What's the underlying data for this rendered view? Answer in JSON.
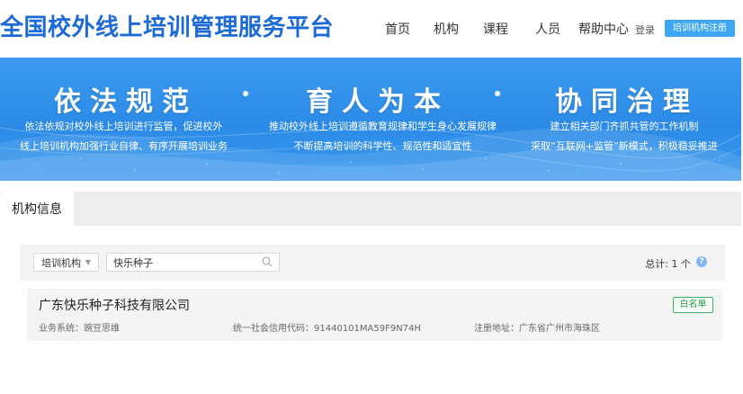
{
  "header": {
    "site_title": "全国校外线上培训管理服务平台",
    "nav": [
      {
        "label": "首页"
      },
      {
        "label": "机构"
      },
      {
        "label": "课程"
      },
      {
        "label": "人员"
      },
      {
        "label": "帮助中心"
      }
    ],
    "login_label": "登录",
    "register_label": "培训机构注册"
  },
  "banner": {
    "slogans": [
      "依法规范",
      "育人为本",
      "协同治理"
    ],
    "descriptions": [
      [
        "依法依规对校外线上培训进行监管，促进校外",
        "线上培训机构加强行业自律、有序开展培训业务"
      ],
      [
        "推动校外线上培训遵循教育规律和学生身心发展规律",
        "不断提高培训的科学性、规范性和适宜性"
      ],
      [
        "建立相关部门齐抓共管的工作机制",
        "采取“互联网+监管”新模式，积极稳妥推进"
      ]
    ]
  },
  "tabs": {
    "active_label": "机构信息"
  },
  "filter": {
    "type_select_value": "培训机构",
    "search_value": "快乐种子",
    "total_text": "总计: 1 个",
    "help_glyph": "?"
  },
  "results": [
    {
      "name": "广东快乐种子科技有限公司",
      "badge": "白名单",
      "business_system": "业务系统：豌豆思维",
      "credit_code": "统一社会信用代码：91440101MA59F9N74H",
      "address": "注册地址：广东省广州市海珠区"
    }
  ],
  "colors": {
    "brand_blue": "#1c6ad6",
    "banner_blue": "#2b8ae6",
    "button_blue": "#3fa6f3",
    "whitelist_green": "#44b066"
  }
}
